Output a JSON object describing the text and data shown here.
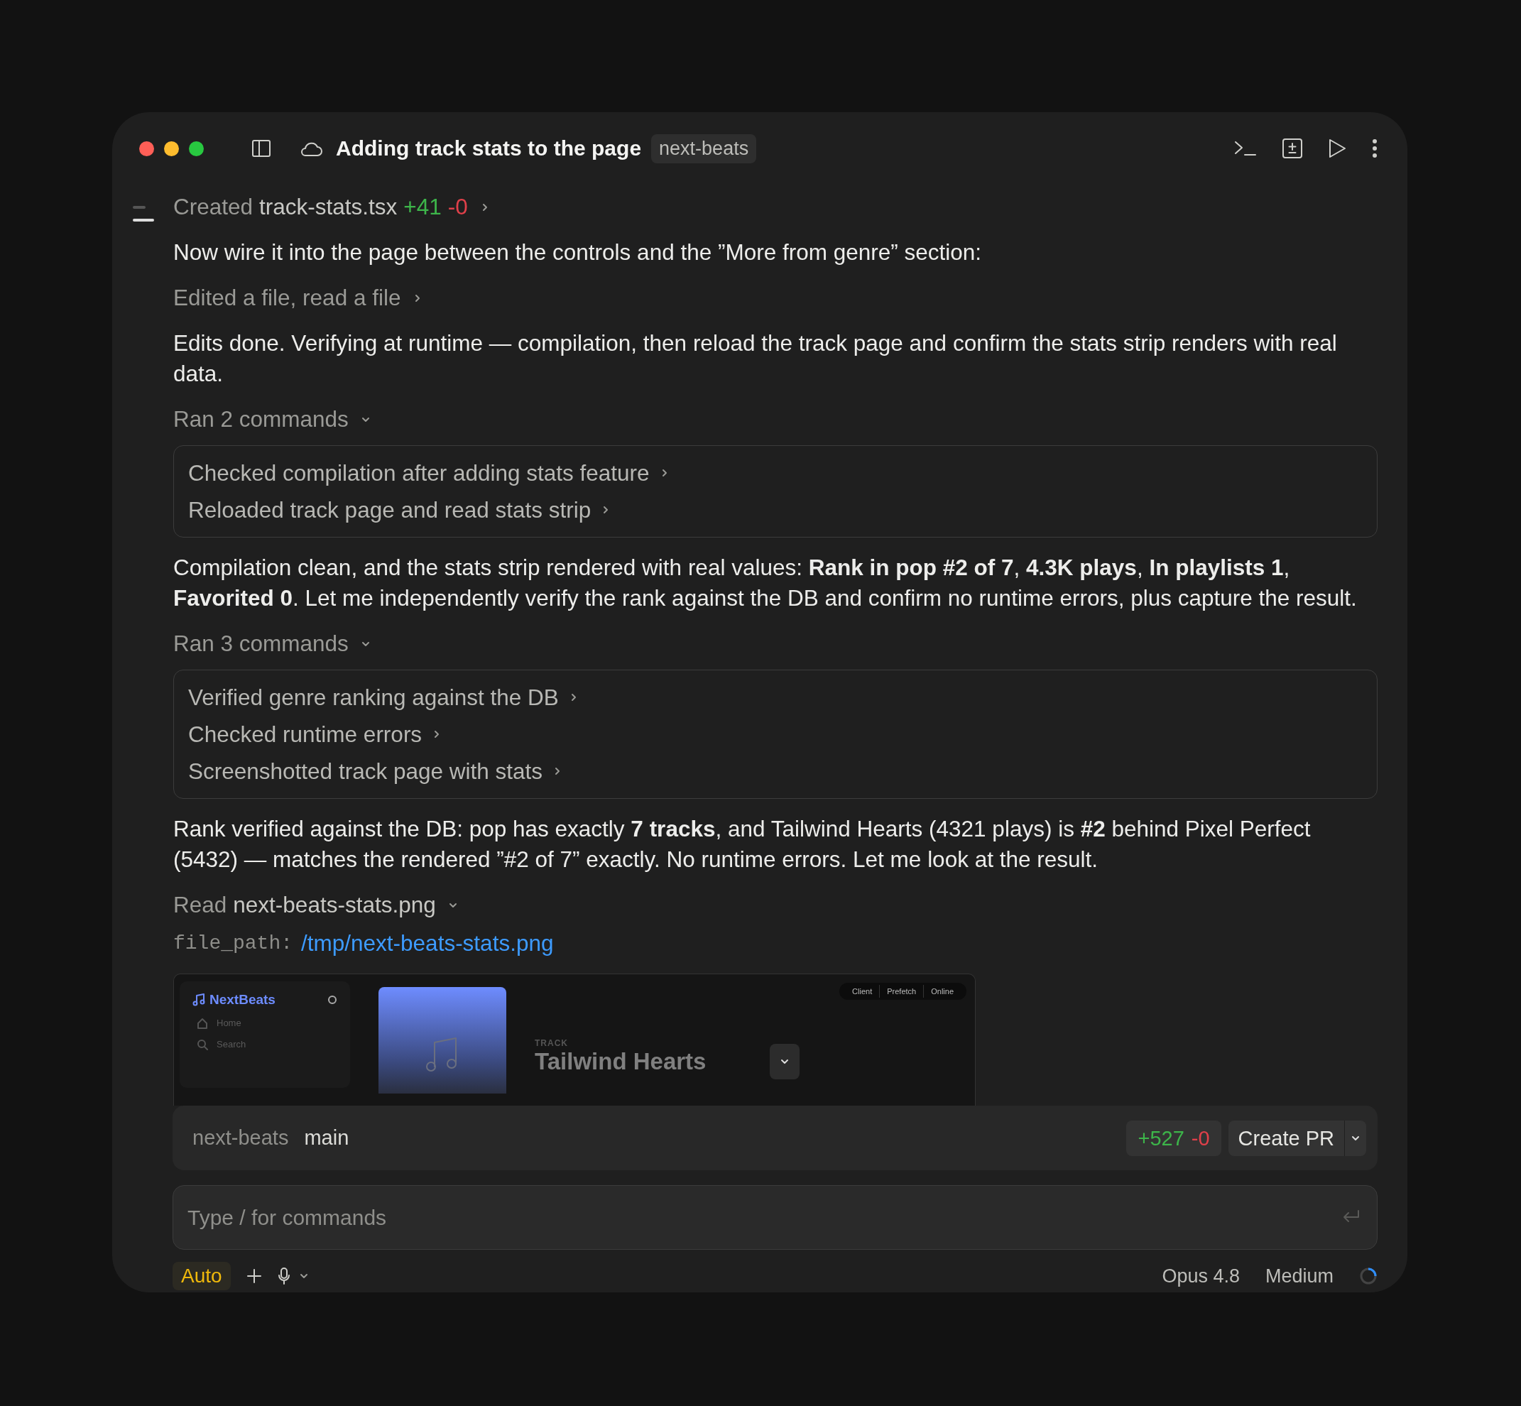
{
  "window": {
    "title": "Adding track stats to the page",
    "repo_tag": "next-beats"
  },
  "transcript": [
    {
      "kind": "file",
      "verb": "Created",
      "file": "track-stats.tsx",
      "added": "+41",
      "removed": "-0",
      "expanded": false
    },
    {
      "kind": "message",
      "text": "Now wire it into the page between the controls and the ”More from genre” section:"
    },
    {
      "kind": "summary",
      "text": "Edited a file, read a file",
      "expanded": false
    },
    {
      "kind": "message",
      "text": "Edits done. Verifying at runtime — compilation, then reload the track page and confirm the stats strip renders with real data."
    },
    {
      "kind": "commands",
      "text": "Ran 2 commands",
      "expanded": true,
      "children": [
        "Checked compilation after adding stats feature",
        "Reloaded track page and read stats strip"
      ]
    },
    {
      "kind": "message",
      "text": "Compilation clean, and the stats strip rendered with real values: **Rank in pop #2 of 7**, **4.3K plays**, **In playlists 1**, **Favorited 0**. Let me independently verify the rank against the DB and confirm no runtime errors, plus capture the result."
    },
    {
      "kind": "commands",
      "text": "Ran 3 commands",
      "expanded": true,
      "children": [
        "Verified genre ranking against the DB",
        "Checked runtime errors",
        "Screenshotted track page with stats"
      ]
    },
    {
      "kind": "message",
      "text": "Rank verified against the DB: pop has exactly **7 tracks**, and Tailwind Hearts (4321 plays) is **#2** behind Pixel Perfect (5432) — matches the rendered ”#2 of 7” exactly. No runtime errors. Let me look at the result."
    },
    {
      "kind": "read",
      "verb": "Read",
      "file": "next-beats-stats.png",
      "expanded": true,
      "param_key": "file_path:",
      "param_value": "/tmp/next-beats-stats.png",
      "preview": {
        "brand": "NextBeats",
        "nav": [
          "Home",
          "Search"
        ],
        "pills": [
          "Client",
          "Prefetch",
          "Online"
        ],
        "eyebrow": "TRACK",
        "track_title": "Tailwind Hearts"
      }
    }
  ],
  "branch_bar": {
    "repo": "next-beats",
    "branch": "main",
    "added": "+527",
    "removed": "-0",
    "button": "Create PR"
  },
  "composer": {
    "placeholder": "Type / for commands"
  },
  "footer": {
    "mode": "Auto",
    "model": "Opus 4.8",
    "effort": "Medium"
  }
}
